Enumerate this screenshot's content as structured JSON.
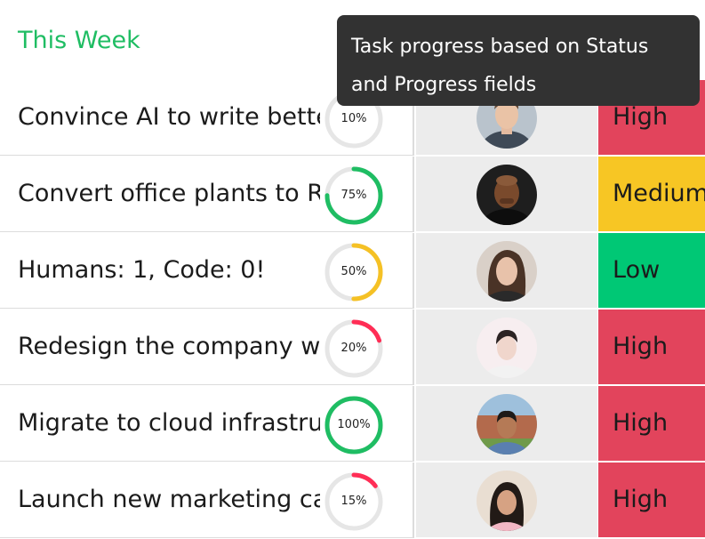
{
  "group": {
    "title": "This Week",
    "title_color": "#1fbd63"
  },
  "tooltip": {
    "text": "Task progress based on Status and Progress fields"
  },
  "colors": {
    "high": "#e2445c",
    "medium": "#f7c624",
    "low": "#00c875",
    "ring_track": "#e6e6e6",
    "owner_bg": "#ececec"
  },
  "rows": [
    {
      "task": "Convince AI to write better",
      "progress": 10,
      "progress_label": "10%",
      "ring_color": "#ff2d55",
      "owner": "avatar-1",
      "priority": "High",
      "priority_color": "#e2445c"
    },
    {
      "task": "Convert office plants to Robots",
      "progress": 75,
      "progress_label": "75%",
      "ring_color": "#1fbd63",
      "owner": "avatar-2",
      "priority": "Medium",
      "priority_color": "#f7c624"
    },
    {
      "task": "Humans: 1, Code: 0!",
      "progress": 50,
      "progress_label": "50%",
      "ring_color": "#f5c125",
      "owner": "avatar-3",
      "priority": "Low",
      "priority_color": "#00c875"
    },
    {
      "task": "Redesign the company website",
      "progress": 20,
      "progress_label": "20%",
      "ring_color": "#ff2d55",
      "owner": "avatar-4",
      "priority": "High",
      "priority_color": "#e2445c"
    },
    {
      "task": "Migrate to cloud infrastructure",
      "progress": 100,
      "progress_label": "100%",
      "ring_color": "#1fbd63",
      "owner": "avatar-5",
      "priority": "High",
      "priority_color": "#e2445c"
    },
    {
      "task": "Launch new marketing campaign",
      "progress": 15,
      "progress_label": "15%",
      "ring_color": "#ff2d55",
      "owner": "avatar-6",
      "priority": "High",
      "priority_color": "#e2445c"
    }
  ]
}
